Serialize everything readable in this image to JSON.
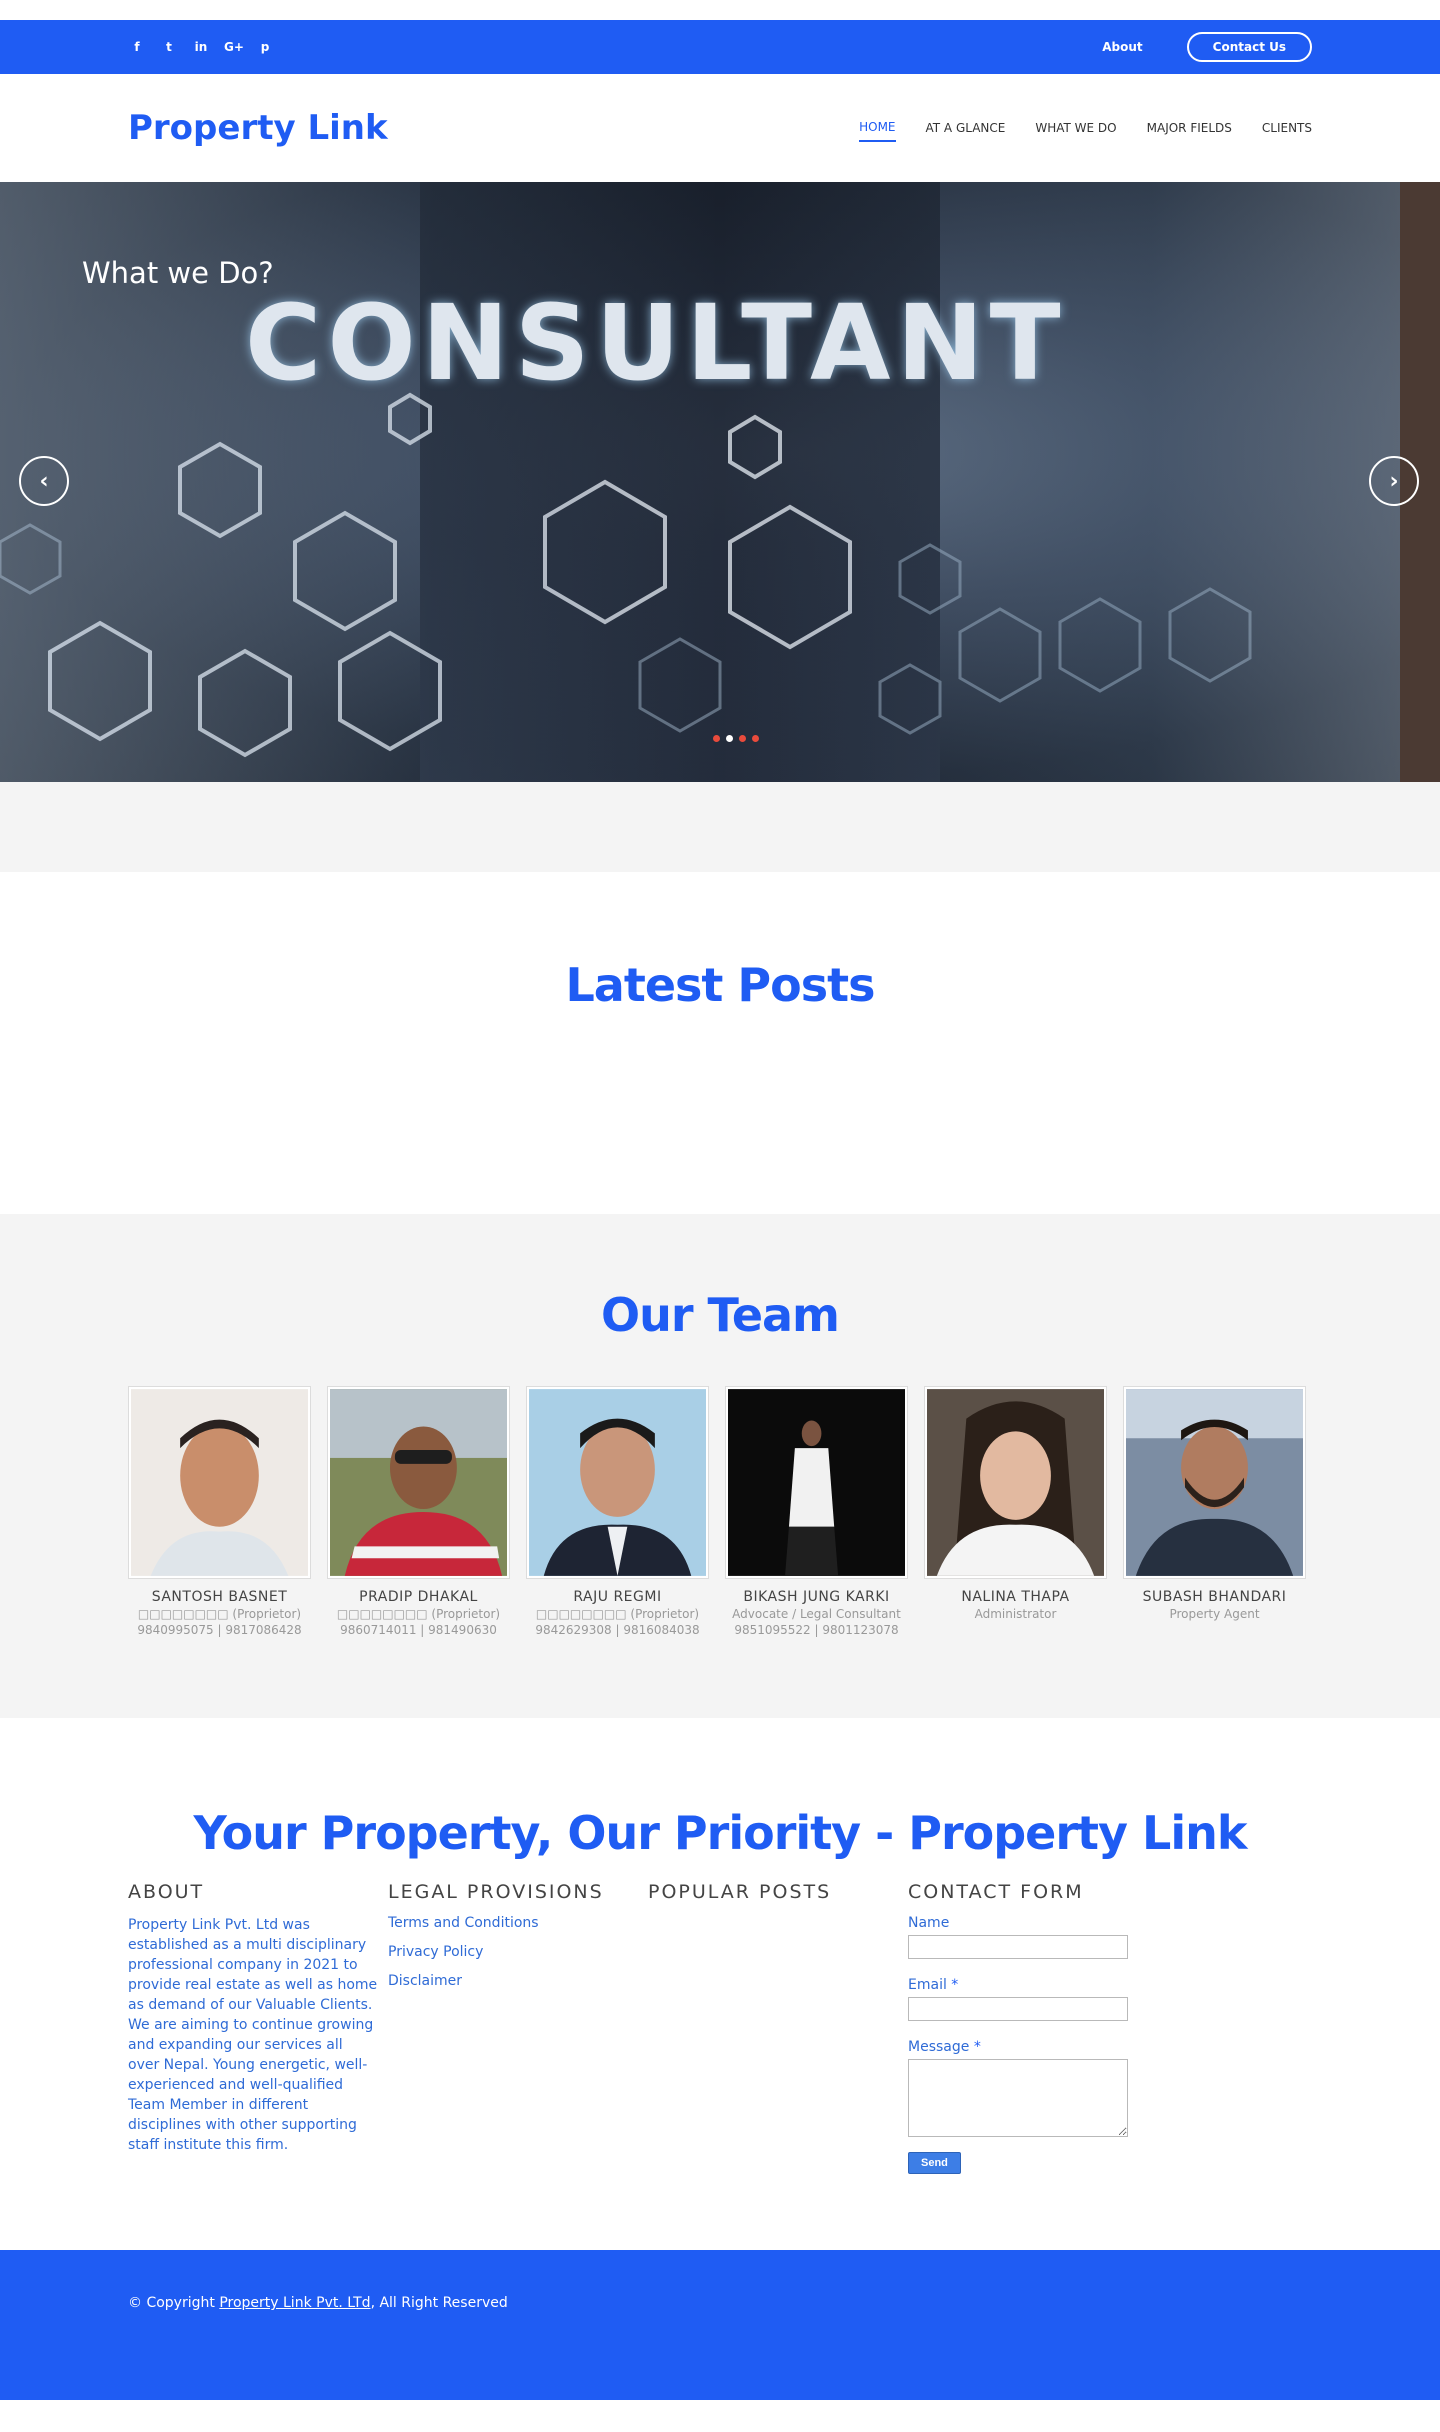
{
  "topbar": {
    "social": [
      {
        "icon": "facebook-icon",
        "glyph": "f"
      },
      {
        "icon": "twitter-icon",
        "glyph": "t"
      },
      {
        "icon": "linkedin-icon",
        "glyph": "in"
      },
      {
        "icon": "google-plus-icon",
        "glyph": "G+"
      },
      {
        "icon": "pinterest-icon",
        "glyph": "p"
      }
    ],
    "about_label": "About",
    "contact_label": "Contact Us"
  },
  "header": {
    "logo": "Property Link",
    "nav": [
      {
        "label": "HOME",
        "active": true
      },
      {
        "label": "AT A GLANCE",
        "active": false
      },
      {
        "label": "WHAT WE DO",
        "active": false
      },
      {
        "label": "MAJOR FIELDS",
        "active": false
      },
      {
        "label": "CLIENTS",
        "active": false
      }
    ]
  },
  "hero": {
    "caption": "What we Do?",
    "image_text": "CONSULTANT",
    "prev_icon": "chevron-left-icon",
    "next_icon": "chevron-right-icon",
    "slides": 4,
    "active_slide": 2
  },
  "posts": {
    "title": "Latest Posts"
  },
  "team": {
    "title": "Our Team",
    "members": [
      {
        "name": "SANTOSH BASNET",
        "role": "□□□□□□□□ (Proprietor)",
        "phone": "9840995075 | 9817086428"
      },
      {
        "name": "PRADIP DHAKAL",
        "role": "□□□□□□□□ (Proprietor)",
        "phone": "9860714011 | 981490630"
      },
      {
        "name": "RAJU REGMI",
        "role": "□□□□□□□□ (Proprietor)",
        "phone": "9842629308 | 9816084038"
      },
      {
        "name": "BIKASH JUNG KARKI",
        "role": "Advocate / Legal Consultant",
        "phone": "9851095522 | 9801123078"
      },
      {
        "name": "NALINA THAPA",
        "role": "Administrator",
        "phone": ""
      },
      {
        "name": "SUBASH BHANDARI",
        "role": "Property Agent",
        "phone": ""
      }
    ]
  },
  "tagline": "Your Property, Our Priority - Property Link",
  "footer_cols": {
    "about": {
      "heading": "ABOUT",
      "text": "Property Link Pvt. Ltd was established as a multi disciplinary professional company in 2021 to provide real estate as well as home as demand of our Valuable Clients. We are aiming to continue growing and expanding our services all over Nepal. Young energetic, well-experienced and well-qualified Team Member in different disciplines with other supporting staff institute this firm."
    },
    "legal": {
      "heading": "LEGAL PROVISIONS",
      "links": [
        "Terms and Conditions",
        "Privacy Policy",
        "Disclaimer"
      ]
    },
    "popular": {
      "heading": "POPULAR POSTS"
    },
    "contact": {
      "heading": "CONTACT FORM",
      "name_label": "Name",
      "email_label": "Email",
      "message_label": "Message",
      "required_mark": "*",
      "send_label": "Send"
    }
  },
  "footer": {
    "prefix": "© Copyright ",
    "link": "Property Link Pvt. LTd",
    "suffix": ", All Right Reserved"
  }
}
